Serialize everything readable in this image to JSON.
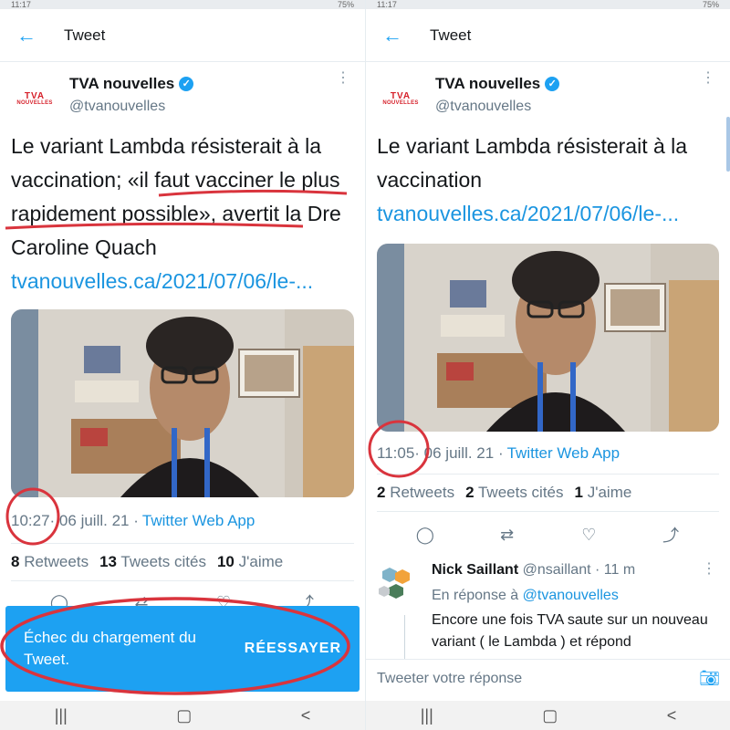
{
  "left": {
    "statusbar": {
      "time": "11:17",
      "battery": "75%"
    },
    "header": {
      "title": "Tweet"
    },
    "tweet": {
      "author_name": "TVA nouvelles",
      "handle": "@tvanouvelles",
      "logo_line1": "TVA",
      "logo_line2": "NOUVELLES",
      "text_part1": "Le variant Lambda résisterait à la vaccination; «il faut vacciner le plus rapidement possible», avertit la Dre Caroline Quach ",
      "link": "tvanouvelles.ca/2021/07/06/le-...",
      "time": "10:27",
      "date": " · 06 juill. 21 · ",
      "app": "Twitter Web App",
      "retweets_count": "8",
      "retweets_label": "Retweets",
      "quotes_count": "13",
      "quotes_label": "Tweets cités",
      "likes_count": "10",
      "likes_label": "J'aime"
    },
    "snackbar": {
      "message": "Échec du chargement du Tweet.",
      "action": "RÉESSAYER"
    }
  },
  "right": {
    "statusbar": {
      "time": "11:17",
      "battery": "75%"
    },
    "header": {
      "title": "Tweet"
    },
    "tweet": {
      "author_name": "TVA nouvelles",
      "handle": "@tvanouvelles",
      "logo_line1": "TVA",
      "logo_line2": "NOUVELLES",
      "text_part1": "Le variant Lambda résisterait à la vaccination ",
      "link": "tvanouvelles.ca/2021/07/06/le-...",
      "time": "11:05",
      "date": " · 06 juill. 21 · ",
      "app": "Twitter Web App",
      "retweets_count": "2",
      "retweets_label": "Retweets",
      "quotes_count": "2",
      "quotes_label": "Tweets cités",
      "likes_count": "1",
      "likes_label": "J'aime"
    },
    "reply": {
      "name": "Nick Saillant",
      "handle_time": " @nsaillant · 11 m",
      "in_reply_prefix": "En réponse à ",
      "in_reply_handle": "@tvanouvelles",
      "text": "Encore une fois TVA saute sur un nouveau variant ( le Lambda ) et répond"
    },
    "compose": {
      "placeholder": "Tweeter votre réponse"
    }
  },
  "colors": {
    "twitter_blue": "#1da1f2",
    "annotation_red": "#d9343d"
  },
  "icons": [
    "back-arrow-icon",
    "verified-icon",
    "more-icon",
    "reply-icon",
    "retweet-icon",
    "like-icon",
    "share-icon",
    "camera-icon",
    "recents-icon",
    "home-icon",
    "back-nav-icon"
  ]
}
